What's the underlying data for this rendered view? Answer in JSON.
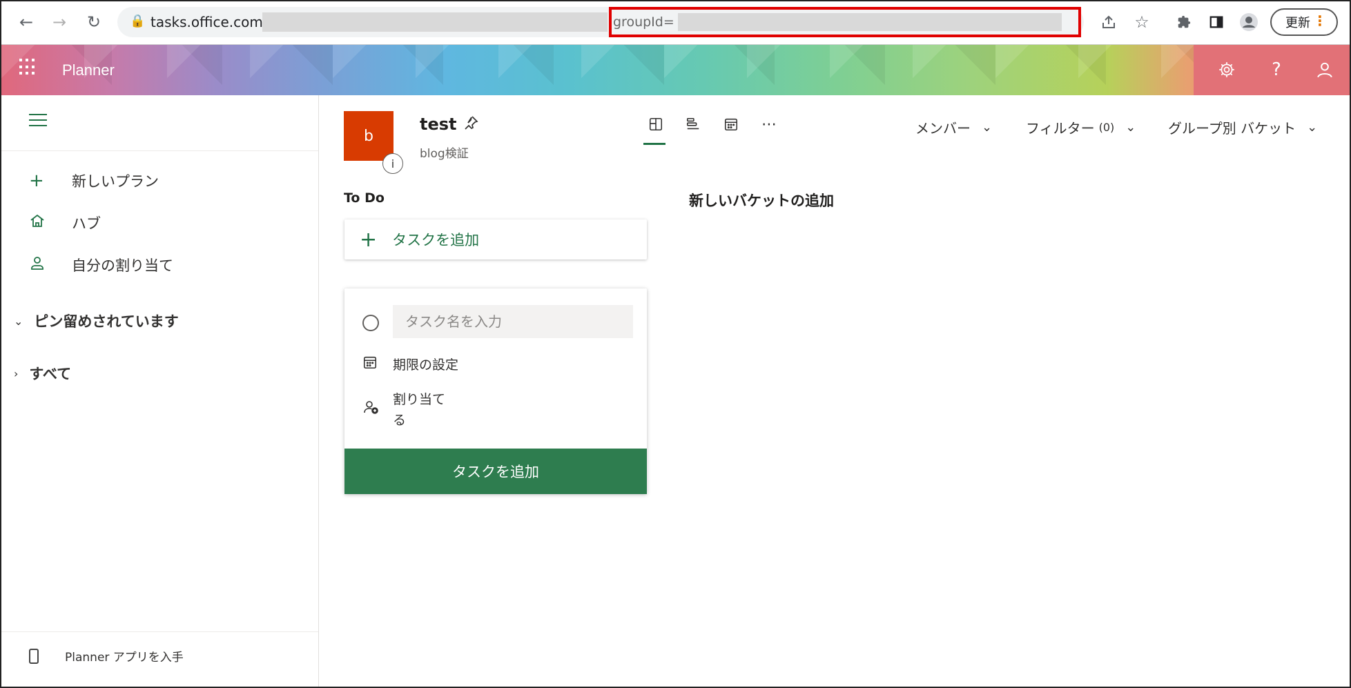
{
  "browser": {
    "url_visible": "tasks.office.com/",
    "url_highlight": "groupId=",
    "update_label": "更新"
  },
  "header": {
    "app_title": "Planner"
  },
  "sidebar": {
    "items": [
      {
        "label": "新しいプラン",
        "icon": "plus-icon"
      },
      {
        "label": "ハブ",
        "icon": "home-icon"
      },
      {
        "label": "自分の割り当て",
        "icon": "person-icon"
      }
    ],
    "sections": [
      {
        "label": "ピン留めされています",
        "expanded": true
      },
      {
        "label": "すべて",
        "expanded": false
      }
    ],
    "footer": "Planner アプリを入手"
  },
  "plan": {
    "avatar_letter": "b",
    "name": "test",
    "group": "blog検証"
  },
  "filters": {
    "members": "メンバー",
    "filter": "フィルター",
    "filter_count": "(0)",
    "group_by": "グループ別 バケット"
  },
  "board": {
    "bucket_title": "To Do",
    "add_task_label": "タスクを追加",
    "new_bucket": "新しいバケットの追加",
    "card": {
      "placeholder": "タスク名を入力",
      "due_label": "期限の設定",
      "assign_label_1": "割り当て",
      "assign_label_2": "る",
      "submit_label": "タスクを追加"
    }
  },
  "colors": {
    "brand_green": "#217346",
    "plan_avatar": "#d83b01",
    "submit_green": "#2e7d4f",
    "highlight_red": "#e00000"
  }
}
